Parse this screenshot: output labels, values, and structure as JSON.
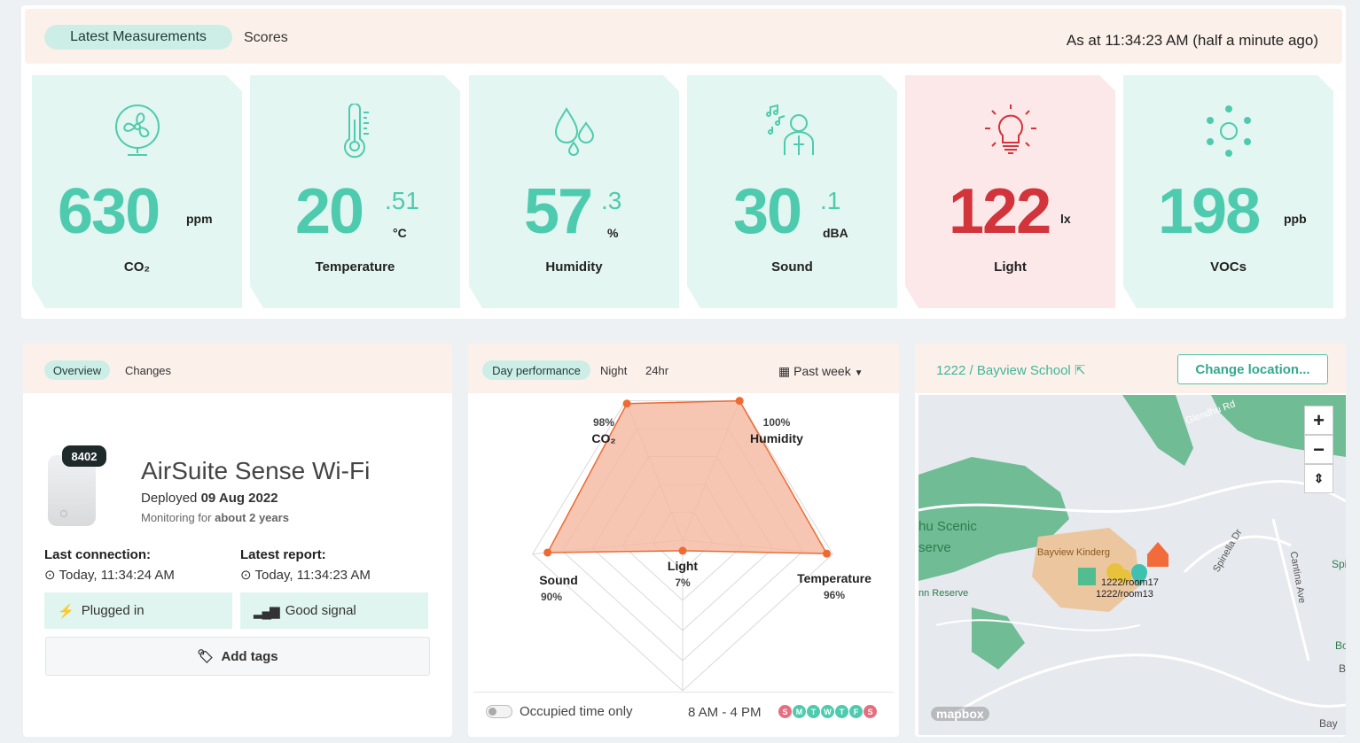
{
  "header": {
    "tab_latest": "Latest Measurements",
    "tab_scores": "Scores",
    "timestamp": "As at 11:34:23 AM (half a minute ago)"
  },
  "tiles": [
    {
      "icon": "fan-icon",
      "value": "630",
      "decimal": "",
      "unit": "ppm",
      "label": "CO₂",
      "status_color": "#4ecbae"
    },
    {
      "icon": "thermometer-icon",
      "value": "20",
      "decimal": ".51",
      "unit": "°C",
      "label": "Temperature",
      "status_color": "#4ecbae"
    },
    {
      "icon": "droplets-icon",
      "value": "57",
      "decimal": ".3",
      "unit": "%",
      "label": "Humidity",
      "status_color": "#4ecbae"
    },
    {
      "icon": "singer-icon",
      "value": "30",
      "decimal": ".1",
      "unit": "dBA",
      "label": "Sound",
      "status_color": "#4ecbae"
    },
    {
      "icon": "lightbulb-icon",
      "value": "122",
      "decimal": "",
      "unit": "lx",
      "label": "Light",
      "status_color": "#d1343b"
    },
    {
      "icon": "vocs-icon",
      "value": "198",
      "decimal": "",
      "unit": "ppb",
      "label": "VOCs",
      "status_color": "#4ecbae"
    }
  ],
  "device": {
    "tab_overview": "Overview",
    "tab_changes": "Changes",
    "serial": "8402",
    "name": "AirSuite Sense Wi-Fi",
    "deployed_label": "Deployed",
    "deployed_date": "09 Aug 2022",
    "monitoring_label": "Monitoring for",
    "monitoring_duration": "about 2 years",
    "last_connection_label": "Last connection:",
    "last_connection_value": "Today, 11:34:24 AM",
    "latest_report_label": "Latest report:",
    "latest_report_value": "Today, 11:34:23 AM",
    "power_status": "Plugged in",
    "signal_status": "Good signal",
    "add_tags": "Add tags"
  },
  "performance": {
    "tab_day": "Day performance",
    "tab_night": "Night",
    "tab_24hr": "24hr",
    "period": "Past week",
    "occupied_label": "Occupied time only",
    "hours": "8 AM - 4 PM",
    "days": [
      "S",
      "M",
      "T",
      "W",
      "T",
      "F",
      "S"
    ],
    "day_colors": [
      "#e56f7f",
      "#4ecbae",
      "#4ecbae",
      "#4ecbae",
      "#4ecbae",
      "#4ecbae",
      "#e56f7f"
    ]
  },
  "location": {
    "title": "1222 / Bayview School",
    "change_button": "Change location...",
    "map_labels": {
      "road_glendhu": "Glendhu Rd",
      "scenic": "hu Scenic",
      "reserve": "serve",
      "reserve2": "nn Reserve",
      "kinder": "Bayview Kinderg",
      "room17": "1222/room17",
      "room13": "1222/room13",
      "spinella": "Spinella Dr",
      "cantina": "Cantina Ave",
      "spi": "Spi",
      "bo": "Bo",
      "b": "B",
      "bay": "Bay",
      "mapbox": "mapbox"
    }
  },
  "chart_data": {
    "type": "radar",
    "categories": [
      "CO₂",
      "Humidity",
      "Temperature",
      "Light",
      "Sound"
    ],
    "values": [
      98,
      100,
      96,
      7,
      90
    ],
    "value_labels": [
      "98%",
      "100%",
      "96%",
      "7%",
      "90%"
    ],
    "range": [
      0,
      100
    ],
    "fill_color": "#f5b8a0",
    "line_color": "#ee6a33"
  }
}
